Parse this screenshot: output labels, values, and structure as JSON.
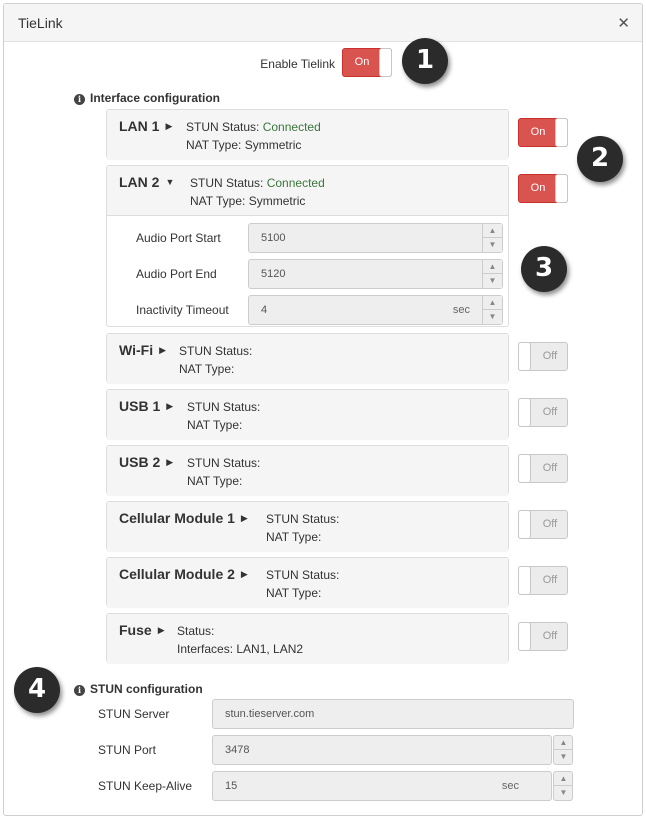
{
  "dialog": {
    "title": "TieLink"
  },
  "enable": {
    "label": "Enable Tielink",
    "state": "On"
  },
  "interface_config": {
    "title": "Interface configuration",
    "interfaces": [
      {
        "name": "LAN 1",
        "line1_label": "STUN Status:",
        "line1_value": "Connected",
        "line2": "NAT Type: Symmetric",
        "toggle": "On",
        "expanded": false
      },
      {
        "name": "LAN 2",
        "line1_label": "STUN Status:",
        "line1_value": "Connected",
        "line2": "NAT Type: Symmetric",
        "toggle": "On",
        "expanded": true,
        "fields": [
          {
            "label": "Audio Port Start",
            "value": "5100",
            "unit": ""
          },
          {
            "label": "Audio Port End",
            "value": "5120",
            "unit": ""
          },
          {
            "label": "Inactivity Timeout",
            "value": "4",
            "unit": "sec"
          }
        ]
      },
      {
        "name": "Wi-Fi",
        "line1_label": "STUN Status:",
        "line1_value": "",
        "line2": "NAT Type:",
        "toggle": "Off",
        "expanded": false
      },
      {
        "name": "USB 1",
        "line1_label": "STUN Status:",
        "line1_value": "",
        "line2": "NAT Type:",
        "toggle": "Off",
        "expanded": false
      },
      {
        "name": "USB 2",
        "line1_label": "STUN Status:",
        "line1_value": "",
        "line2": "NAT Type:",
        "toggle": "Off",
        "expanded": false
      },
      {
        "name": "Cellular Module 1",
        "line1_label": "STUN Status:",
        "line1_value": "",
        "line2": "NAT Type:",
        "toggle": "Off",
        "expanded": false
      },
      {
        "name": "Cellular Module 2",
        "line1_label": "STUN Status:",
        "line1_value": "",
        "line2": "NAT Type:",
        "toggle": "Off",
        "expanded": false
      },
      {
        "name": "Fuse",
        "line1_label": "Status:",
        "line1_value": "",
        "line2": "Interfaces: LAN1, LAN2",
        "toggle": "Off",
        "expanded": false
      }
    ]
  },
  "stun_config": {
    "title": "STUN configuration",
    "fields": [
      {
        "label": "STUN Server",
        "value": "stun.tieserver.com",
        "unit": ""
      },
      {
        "label": "STUN Port",
        "value": "3478",
        "unit": ""
      },
      {
        "label": "STUN Keep-Alive",
        "value": "15",
        "unit": "sec"
      }
    ]
  },
  "callouts": [
    "1",
    "2",
    "3",
    "4"
  ],
  "colors": {
    "toggle_on": "#d9534f",
    "connected": "#3c763d",
    "badge": "#2b2b2b"
  },
  "icons": {
    "close": "close-icon",
    "info": "info-icon",
    "caret_collapsed": "caret-right-icon",
    "caret_expanded": "caret-down-icon",
    "spinner_up": "chevron-up-icon",
    "spinner_down": "chevron-down-icon"
  }
}
